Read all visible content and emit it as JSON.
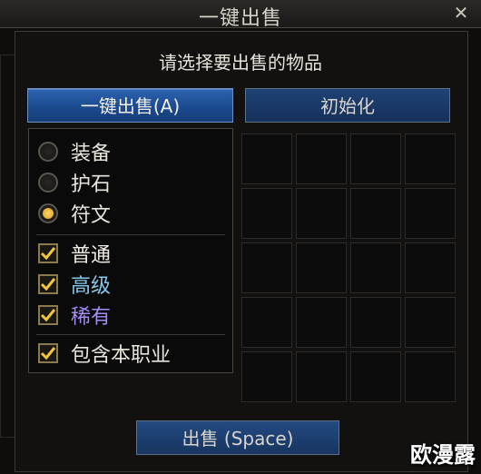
{
  "window": {
    "title": "一键出售",
    "close_icon": "close-icon"
  },
  "prompt": "请选择要出售的物品",
  "buttons": {
    "auto_sell": "一键出售(A)",
    "reset": "初始化",
    "sell": "出售 (Space)"
  },
  "categories": [
    {
      "label": "装备",
      "selected": false
    },
    {
      "label": "护石",
      "selected": false
    },
    {
      "label": "符文",
      "selected": true
    }
  ],
  "rarities": [
    {
      "label": "普通",
      "checked": true,
      "color": "#f0ece4"
    },
    {
      "label": "高级",
      "checked": true,
      "color": "#86c8ec"
    },
    {
      "label": "稀有",
      "checked": true,
      "color": "#a58cf0"
    }
  ],
  "include_equipped": {
    "label": "包含本职业",
    "checked": true
  },
  "watermark": "欧漫露"
}
